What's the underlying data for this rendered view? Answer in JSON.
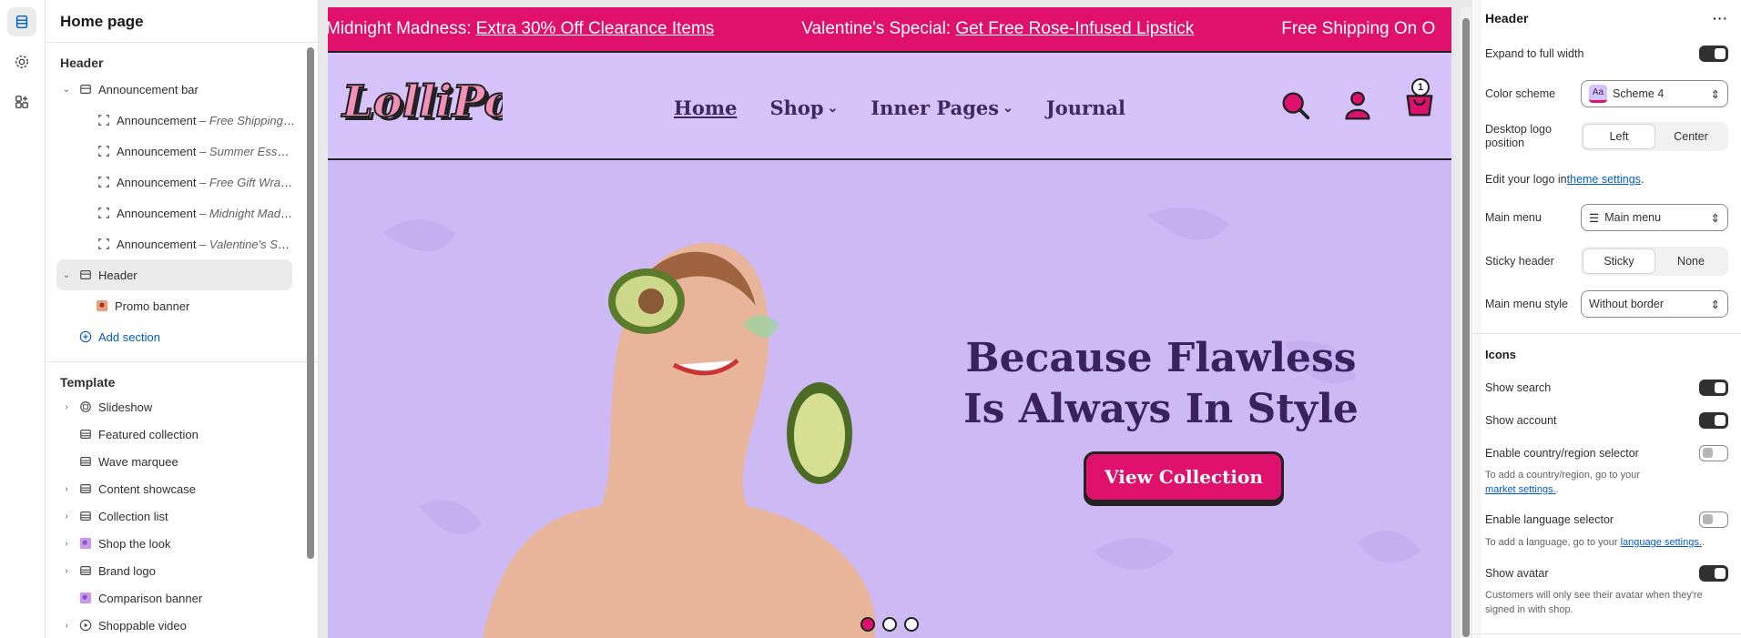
{
  "sections_panel": {
    "title": "Home page",
    "header_group": "Header",
    "announcement_bar": "Announcement bar",
    "announcements": [
      {
        "prefix": "Announcement",
        "suffix": "– Free Shipping ..."
      },
      {
        "prefix": "Announcement",
        "suffix": "– Summer Essen..."
      },
      {
        "prefix": "Announcement",
        "suffix": "– Free Gift Wrap..."
      },
      {
        "prefix": "Announcement",
        "suffix": "– Midnight Madn..."
      },
      {
        "prefix": "Announcement",
        "suffix": "– Valentine's Spe..."
      }
    ],
    "header_item": "Header",
    "promo_banner": "Promo banner",
    "add_section": "Add section",
    "template_group": "Template",
    "template_items": [
      "Slideshow",
      "Featured collection",
      "Wave marquee",
      "Content showcase",
      "Collection list",
      "Shop the look",
      "Brand logo",
      "Comparison banner",
      "Shoppable video"
    ]
  },
  "preview": {
    "announcements": [
      {
        "lead": "Midnight Madness: ",
        "link": "Extra 30% Off Clearance Items"
      },
      {
        "lead": "Valentine's Special: ",
        "link": "Get Free Rose-Infused Lipstick"
      },
      {
        "lead": "Free Shipping On O",
        "link": ""
      }
    ],
    "logo_text": "LolliPop",
    "nav": [
      "Home",
      "Shop",
      "Inner Pages",
      "Journal"
    ],
    "cart_count": "1",
    "hero_title_line1": "Because Flawless",
    "hero_title_line2": "Is Always In Style",
    "hero_button": "View Collection",
    "slide_dots": 3,
    "active_slide": 1,
    "colors": {
      "brand_pink": "#e0116c",
      "lavender": "#cdb9f4",
      "ink": "#3a225f"
    }
  },
  "settings": {
    "title": "Header",
    "more_label": "···",
    "expand_full_width": {
      "label": "Expand to full width",
      "on": true
    },
    "color_scheme": {
      "label": "Color scheme",
      "value": "Scheme 4",
      "swatch": "Aa"
    },
    "logo_position": {
      "label": "Desktop logo position",
      "options": [
        "Left",
        "Center"
      ],
      "selected": "Left"
    },
    "logo_note": {
      "text": "Edit your logo in ",
      "link": "theme settings",
      "end": "."
    },
    "main_menu": {
      "label": "Main menu",
      "value": "Main menu"
    },
    "sticky_header": {
      "label": "Sticky header",
      "options": [
        "Sticky",
        "None"
      ],
      "selected": "Sticky"
    },
    "main_menu_style": {
      "label": "Main menu style",
      "value": "Without border"
    },
    "icons_heading": "Icons",
    "show_search": {
      "label": "Show search",
      "on": true
    },
    "show_account": {
      "label": "Show account",
      "on": true
    },
    "country_selector": {
      "label": "Enable country/region selector",
      "on": false,
      "note": "To add a country/region, go to your ",
      "link": "market settings.",
      "end": "."
    },
    "language_selector": {
      "label": "Enable language selector",
      "on": false,
      "note": "To add a language, go to your ",
      "link": "language settings.",
      "end": "."
    },
    "show_avatar": {
      "label": "Show avatar",
      "on": true,
      "note": "Customers will only see their avatar when they're signed in with shop."
    }
  }
}
